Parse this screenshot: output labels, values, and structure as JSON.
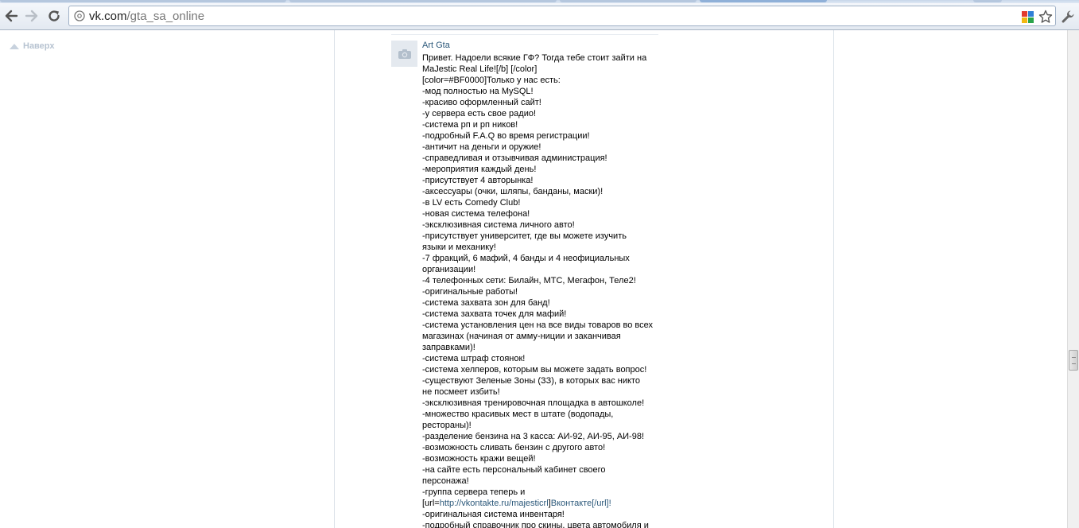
{
  "browser": {
    "url_host": "vk.com",
    "url_path": "/gta_sa_online"
  },
  "page": {
    "to_top_label": "Наверх",
    "post": {
      "author": "Art Gta",
      "lines": [
        "Привет. Надоели всякие ГФ? Тогда тебе стоит зайти на",
        "MaJestic Real Life![/b] [/color]",
        "[color=#BF0000]Только у нас есть:",
        "-мод полностью на MySQL!",
        "-красиво оформленный сайт!",
        "-у сервера есть свое радио!",
        "-система рп и рп ников!",
        "-подробный F.A.Q во время регистрации!",
        "-античит на деньги и оружие!",
        "-справедливая и отзывчивая администрация!",
        "-мероприятия каждый день!",
        "-присутствует 4 авторынка!",
        "-аксессуары (очки, шляпы, банданы, маски)!",
        "-в LV есть Comedy Club!",
        "-новая система телефона!",
        "-эксклюзивная система личного авто!",
        "-присутствует университет, где вы можете изучить",
        "языки и механику!",
        "-7 фракций, 6 мафий, 4 банды и 4 неофициальных",
        "организации!",
        "-4 телефонных сети: Билайн, МТС, Мегафон, Теле2!",
        "-оригинальные работы!",
        "-система захвата зон для банд!",
        "-система захвата точек для мафий!",
        "-система установления цен на все виды товаров во всех",
        "магазинах (начиная от амму-ниции и заканчивая",
        "заправками)!",
        "-система штраф стоянок!",
        "-система хелперов, которым вы можете задать вопрос!",
        "-существуют Зеленые Зоны (ЗЗ), в которых вас никто",
        "не посмеет избить!",
        "-эксклюзивная тренировочная площадка в автошколе!",
        "-множество красивых мест в штате (водопады,",
        "рестораны)!",
        "-разделение бензина на 3 касса: АИ-92, АИ-95, АИ-98!",
        "-возможность сливать бензин с другого авто!",
        "-возможность кражи вещей!",
        "-на сайте есть персональный кабинет своего",
        "персонажа!",
        "-группа сервера теперь и"
      ],
      "link_line": {
        "pre": "[url=",
        "link": "http://vkontakte.ru/majesticrl",
        "mid": "]",
        "link2": "Вконтакте",
        "post": "[/url]!"
      },
      "after_lines": [
        "-оригинальная система инвентаря!",
        "-подробный справочник про скины, цвета автомобиля и"
      ]
    }
  },
  "colors": {
    "link": "#2b587a",
    "divider": "#dae1e8"
  },
  "icons": {
    "back": "back-arrow-icon",
    "forward": "forward-arrow-icon",
    "reload": "reload-icon",
    "globe": "globe-icon",
    "extension": "extension-icon",
    "star": "bookmark-star-icon",
    "wrench": "wrench-icon",
    "camera": "camera-icon"
  }
}
